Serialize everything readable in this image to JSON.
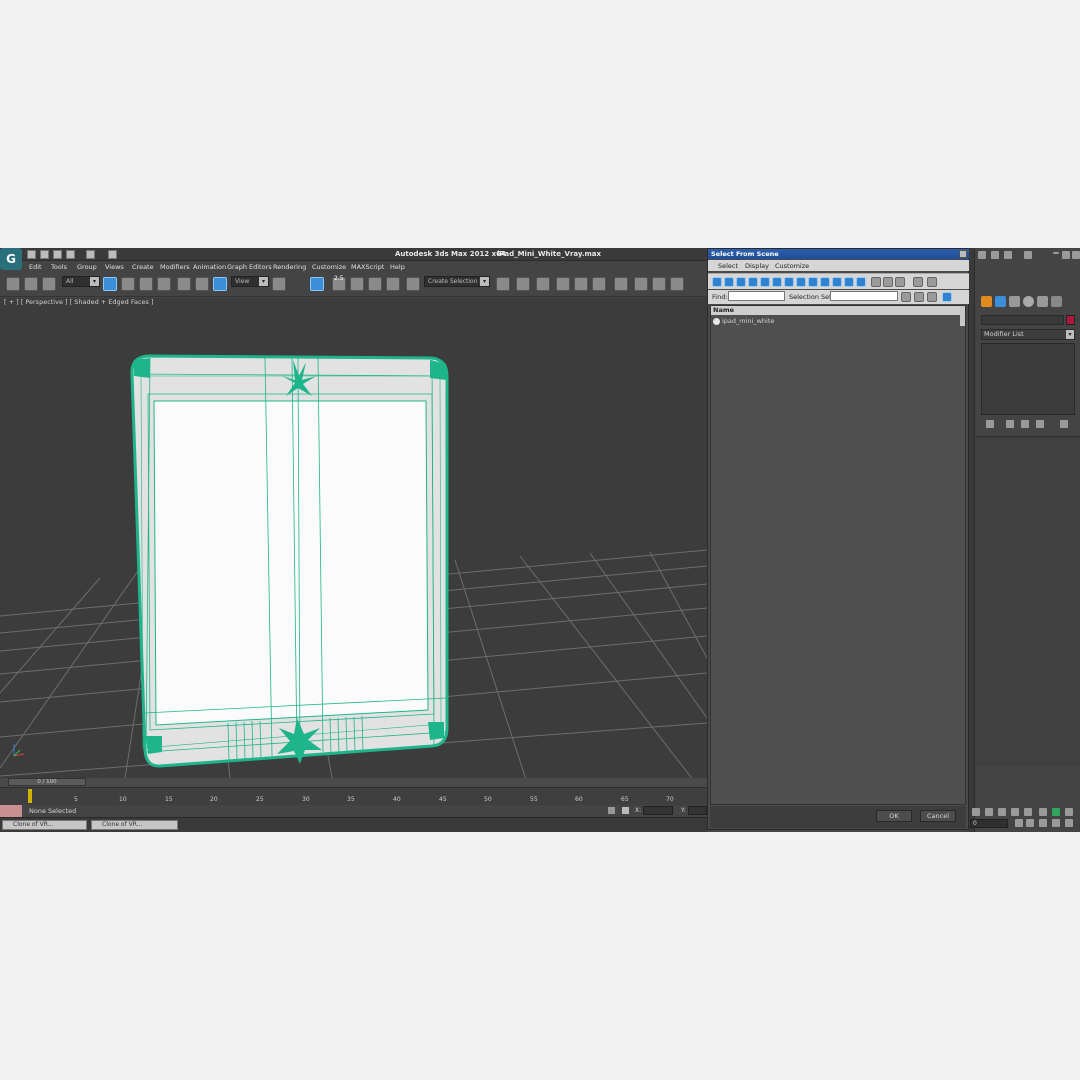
{
  "app": {
    "title": "Autodesk 3ds Max  2012 x64",
    "filename": "iPad_Mini_White_Vray.max",
    "logo_icon": "3dsmax-logo-icon"
  },
  "menu": [
    "Edit",
    "Tools",
    "Group",
    "Views",
    "Create",
    "Modifiers",
    "Animation",
    "Graph Editors",
    "Rendering",
    "Customize",
    "MAXScript",
    "Help"
  ],
  "toolbar": {
    "filter_value": "All",
    "refcoord_value": "View",
    "snap_label": "2.5",
    "named_selection_value": "Create Selection Se"
  },
  "viewport": {
    "label": "[ + ] [ Perspective ] [ Shaded + Edged Faces ]",
    "grid_color": "#6a6a6a",
    "wire_color": "#1fb58a"
  },
  "timeline": {
    "slider_text": "0 / 100",
    "ticks": [
      "5",
      "10",
      "15",
      "20",
      "25",
      "30",
      "35",
      "40",
      "45",
      "50",
      "55",
      "60",
      "65",
      "70"
    ]
  },
  "status": {
    "text": "None Selected",
    "x_label": "X:",
    "y_label": "Y:"
  },
  "taskbar": {
    "items": [
      "Clone of VR...",
      "Clone of VR..."
    ]
  },
  "dialog": {
    "title": "Select From Scene",
    "menu": [
      "Select",
      "Display",
      "Customize"
    ],
    "find_label": "Find:",
    "selection_set_label": "Selection Set:",
    "list_header": "Name",
    "items": [
      "ipad_mini_white"
    ],
    "ok_label": "OK",
    "cancel_label": "Cancel"
  },
  "command_panel": {
    "modifier_list": "Modifier List",
    "color": "#b0173d",
    "frame_value": "0"
  }
}
